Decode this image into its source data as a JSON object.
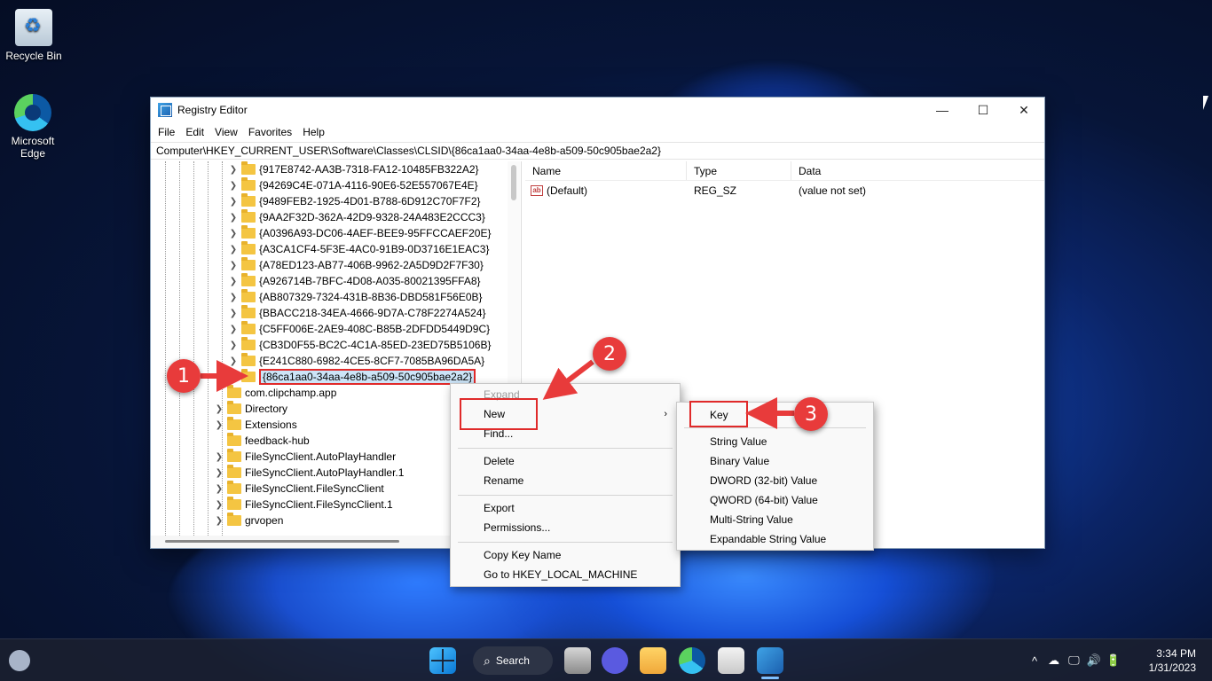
{
  "desktop": {
    "icons": [
      {
        "label": "Recycle Bin"
      },
      {
        "label": "Microsoft Edge"
      }
    ]
  },
  "window": {
    "title": "Registry Editor",
    "controls": {
      "minimize": "—",
      "maximize": "☐",
      "close": "✕"
    },
    "menu": [
      "File",
      "Edit",
      "View",
      "Favorites",
      "Help"
    ],
    "address": "Computer\\HKEY_CURRENT_USER\\Software\\Classes\\CLSID\\{86ca1aa0-34aa-4e8b-a509-50c905bae2a2}"
  },
  "tree": {
    "clsid_children": [
      "{917E8742-AA3B-7318-FA12-10485FB322A2}",
      "{94269C4E-071A-4116-90E6-52E557067E4E}",
      "{9489FEB2-1925-4D01-B788-6D912C70F7F2}",
      "{9AA2F32D-362A-42D9-9328-24A483E2CCC3}",
      "{A0396A93-DC06-4AEF-BEE9-95FFCCAEF20E}",
      "{A3CA1CF4-5F3E-4AC0-91B9-0D3716E1EAC3}",
      "{A78ED123-AB77-406B-9962-2A5D9D2F7F30}",
      "{A926714B-7BFC-4D08-A035-80021395FFA8}",
      "{AB807329-7324-431B-8B36-DBD581F56E0B}",
      "{BBACC218-34EA-4666-9D7A-C78F2274A524}",
      "{C5FF006E-2AE9-408C-B85B-2DFDD5449D9C}",
      "{CB3D0F55-BC2C-4C1A-85ED-23ED75B5106B}",
      "{E241C880-6982-4CE5-8CF7-7085BA96DA5A}"
    ],
    "selected": "{86ca1aa0-34aa-4e8b-a509-50c905bae2a2}",
    "class_keys": [
      "com.clipchamp.app",
      "Directory",
      "Extensions",
      "feedback-hub",
      "FileSyncClient.AutoPlayHandler",
      "FileSyncClient.AutoPlayHandler.1",
      "FileSyncClient.FileSyncClient",
      "FileSyncClient.FileSyncClient.1",
      "grvopen"
    ]
  },
  "values": {
    "columns": [
      "Name",
      "Type",
      "Data"
    ],
    "rows": [
      {
        "name": "(Default)",
        "type": "REG_SZ",
        "data": "(value not set)",
        "icon": "ab"
      }
    ]
  },
  "context_menu": {
    "expand": "Expand",
    "new": "New",
    "find": "Find...",
    "delete": "Delete",
    "rename": "Rename",
    "export": "Export",
    "permissions": "Permissions...",
    "copy_key_name": "Copy Key Name",
    "goto_hklm": "Go to HKEY_LOCAL_MACHINE",
    "submenu_arrow": "›"
  },
  "new_submenu": {
    "key": "Key",
    "items": [
      "String Value",
      "Binary Value",
      "DWORD (32-bit) Value",
      "QWORD (64-bit) Value",
      "Multi-String Value",
      "Expandable String Value"
    ]
  },
  "callouts": [
    "1",
    "2",
    "3"
  ],
  "taskbar": {
    "search_label": "Search",
    "tray_icons": [
      "^",
      "☁",
      "🖵",
      "🔊",
      "🔋"
    ],
    "time": "3:34 PM",
    "date": "1/31/2023"
  },
  "colors": {
    "accent_red": "#e83b3b",
    "selection": "#cce4f7",
    "folder": "#f4c542"
  }
}
